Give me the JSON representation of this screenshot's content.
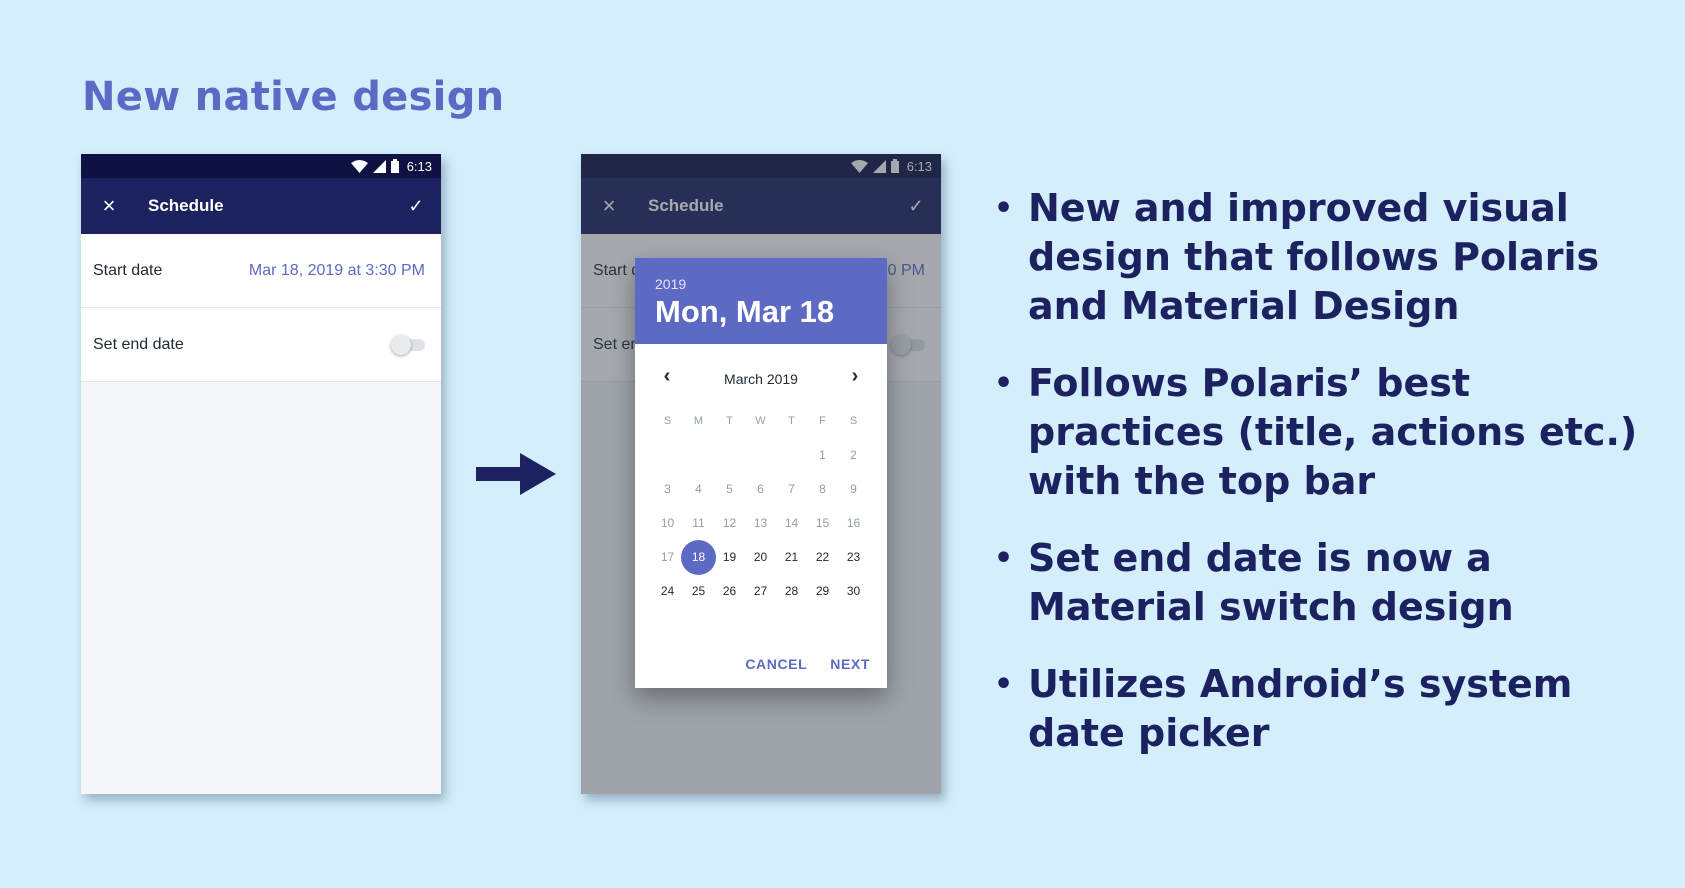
{
  "slide": {
    "title": "New native design"
  },
  "left_screen": {
    "status_time": "6:13",
    "toolbar": {
      "close_icon": "×",
      "title": "Schedule",
      "confirm_icon": "✓"
    },
    "start_date": {
      "label": "Start date",
      "value": "Mar 18, 2019 at 3:30 PM"
    },
    "end_date": {
      "label": "Set end date",
      "switch_on": false
    }
  },
  "right_screen": {
    "status_time": "6:13",
    "toolbar": {
      "close_icon": "×",
      "title": "Schedule",
      "confirm_icon": "✓"
    },
    "background_row_start": {
      "label": "Start d",
      "value": "0 PM"
    },
    "background_row_end": {
      "label": "Set en"
    },
    "date_picker": {
      "year": "2019",
      "selected_date": "Mon, Mar 18",
      "month_label": "March 2019",
      "weekdays": [
        "S",
        "M",
        "T",
        "W",
        "T",
        "F",
        "S"
      ],
      "weeks": [
        [
          "",
          "",
          "",
          "",
          "",
          "1",
          "2"
        ],
        [
          "3",
          "4",
          "5",
          "6",
          "7",
          "8",
          "9"
        ],
        [
          "10",
          "11",
          "12",
          "13",
          "14",
          "15",
          "16"
        ],
        [
          "17",
          "18",
          "19",
          "20",
          "21",
          "22",
          "23"
        ],
        [
          "24",
          "25",
          "26",
          "27",
          "28",
          "29",
          "30"
        ]
      ],
      "selected_day": "18",
      "cancel_label": "CANCEL",
      "next_label": "NEXT"
    }
  },
  "bullets": [
    "New and improved visual design that follows Polaris and Material Design",
    "Follows Polaris’ best practices (title, actions etc.) with the top bar",
    "Set end date is now a Material switch design",
    "Utilizes Android’s system date picker"
  ],
  "colors": {
    "background": "#d4eefc",
    "title": "#5b6ac4",
    "appbar": "#1c2260",
    "statusbar": "#0d1242",
    "accent": "#5c6ac4",
    "bullet_text": "#1c2260"
  }
}
